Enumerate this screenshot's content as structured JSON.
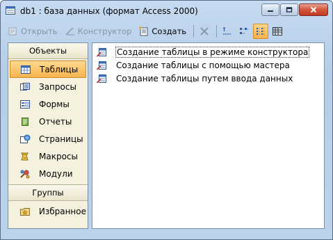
{
  "window": {
    "title": "db1 : база данных (формат Access 2000)"
  },
  "toolbar": {
    "open_label": "Открыть",
    "design_label": "Конструктор",
    "create_label": "Создать"
  },
  "objects_group": {
    "header": "Объекты",
    "items": [
      {
        "label": "Таблицы",
        "icon": "table-icon",
        "selected": true
      },
      {
        "label": "Запросы",
        "icon": "query-icon"
      },
      {
        "label": "Формы",
        "icon": "form-icon"
      },
      {
        "label": "Отчеты",
        "icon": "report-icon"
      },
      {
        "label": "Страницы",
        "icon": "page-icon"
      },
      {
        "label": "Макросы",
        "icon": "macro-icon"
      },
      {
        "label": "Модули",
        "icon": "module-icon"
      }
    ]
  },
  "groups_group": {
    "header": "Группы",
    "items": [
      {
        "label": "Избранное",
        "icon": "favorites-icon"
      }
    ]
  },
  "shortcuts": [
    {
      "label": "Создание таблицы в режиме конструктора"
    },
    {
      "label": "Создание таблицы с помощью мастера"
    },
    {
      "label": "Создание таблицы путем ввода данных"
    }
  ]
}
